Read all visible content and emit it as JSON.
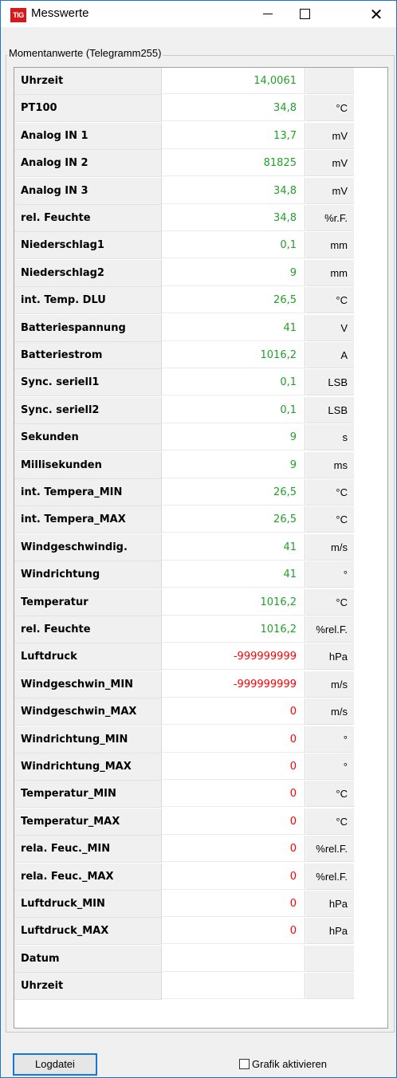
{
  "window": {
    "title": "Messwerte",
    "icon_text": "TIG",
    "minimize": "—",
    "maximize": "☐",
    "close": "✕"
  },
  "group": {
    "label": "Momentanwerte (Telegramm255)"
  },
  "rows": [
    {
      "name": "Uhrzeit",
      "value": "14,0061",
      "unit": "",
      "value_color": "green"
    },
    {
      "name": "PT100",
      "value": "34,8",
      "unit": "°C",
      "value_color": "green"
    },
    {
      "name": "Analog IN 1",
      "value": "13,7",
      "unit": "mV",
      "value_color": "green"
    },
    {
      "name": "Analog IN 2",
      "value": "81825",
      "unit": "mV",
      "value_color": "green"
    },
    {
      "name": "Analog IN 3",
      "value": "34,8",
      "unit": "mV",
      "value_color": "green"
    },
    {
      "name": "rel. Feuchte",
      "value": "34,8",
      "unit": "%r.F.",
      "value_color": "green"
    },
    {
      "name": "Niederschlag1",
      "value": "0,1",
      "unit": "mm",
      "value_color": "green"
    },
    {
      "name": "Niederschlag2",
      "value": "9",
      "unit": "mm",
      "value_color": "green"
    },
    {
      "name": "int. Temp. DLU",
      "value": "26,5",
      "unit": "°C",
      "value_color": "green"
    },
    {
      "name": "Batteriespannung",
      "value": "41",
      "unit": "V",
      "value_color": "green"
    },
    {
      "name": "Batteriestrom",
      "value": "1016,2",
      "unit": "A",
      "value_color": "green"
    },
    {
      "name": "Sync. seriell1",
      "value": "0,1",
      "unit": "LSB",
      "value_color": "green"
    },
    {
      "name": "Sync. seriell2",
      "value": "0,1",
      "unit": "LSB",
      "value_color": "green"
    },
    {
      "name": "Sekunden",
      "value": "9",
      "unit": "s",
      "value_color": "green"
    },
    {
      "name": "Millisekunden",
      "value": "9",
      "unit": "ms",
      "value_color": "green"
    },
    {
      "name": "int. Tempera_MIN",
      "value": "26,5",
      "unit": "°C",
      "value_color": "green"
    },
    {
      "name": "int. Tempera_MAX",
      "value": "26,5",
      "unit": "°C",
      "value_color": "green"
    },
    {
      "name": "Windgeschwindig.",
      "value": "41",
      "unit": "m/s",
      "value_color": "green"
    },
    {
      "name": "Windrichtung",
      "value": "41",
      "unit": "°",
      "value_color": "green"
    },
    {
      "name": "Temperatur",
      "value": "1016,2",
      "unit": "°C",
      "value_color": "green"
    },
    {
      "name": "rel. Feuchte",
      "value": "1016,2",
      "unit": "%rel.F.",
      "value_color": "green"
    },
    {
      "name": "Luftdruck",
      "value": "-999999999",
      "unit": "hPa",
      "value_color": "red"
    },
    {
      "name": "Windgeschwin_MIN",
      "value": "-999999999",
      "unit": "m/s",
      "value_color": "red"
    },
    {
      "name": "Windgeschwin_MAX",
      "value": "0",
      "unit": "m/s",
      "value_color": "red"
    },
    {
      "name": "Windrichtung_MIN",
      "value": "0",
      "unit": "°",
      "value_color": "red"
    },
    {
      "name": "Windrichtung_MAX",
      "value": "0",
      "unit": "°",
      "value_color": "red"
    },
    {
      "name": "Temperatur_MIN",
      "value": "0",
      "unit": "°C",
      "value_color": "red"
    },
    {
      "name": "Temperatur_MAX",
      "value": "0",
      "unit": "°C",
      "value_color": "red"
    },
    {
      "name": "rela. Feuc._MIN",
      "value": "0",
      "unit": "%rel.F.",
      "value_color": "red"
    },
    {
      "name": "rela. Feuc._MAX",
      "value": "0",
      "unit": "%rel.F.",
      "value_color": "red"
    },
    {
      "name": "Luftdruck_MIN",
      "value": "0",
      "unit": "hPa",
      "value_color": "red"
    },
    {
      "name": "Luftdruck_MAX",
      "value": "0",
      "unit": "hPa",
      "value_color": "red"
    },
    {
      "name": "Datum",
      "value": "",
      "unit": "",
      "value_color": "dark"
    },
    {
      "name": "Uhrzeit",
      "value": "",
      "unit": "",
      "value_color": "dark"
    }
  ],
  "footer": {
    "log_button": "Logdatei",
    "checkbox_label": "Grafik aktivieren",
    "checkbox_checked": false
  },
  "colors": {
    "green_value": "#22a02a",
    "red_value": "#ff0000",
    "accent_border": "#1a73d6"
  }
}
